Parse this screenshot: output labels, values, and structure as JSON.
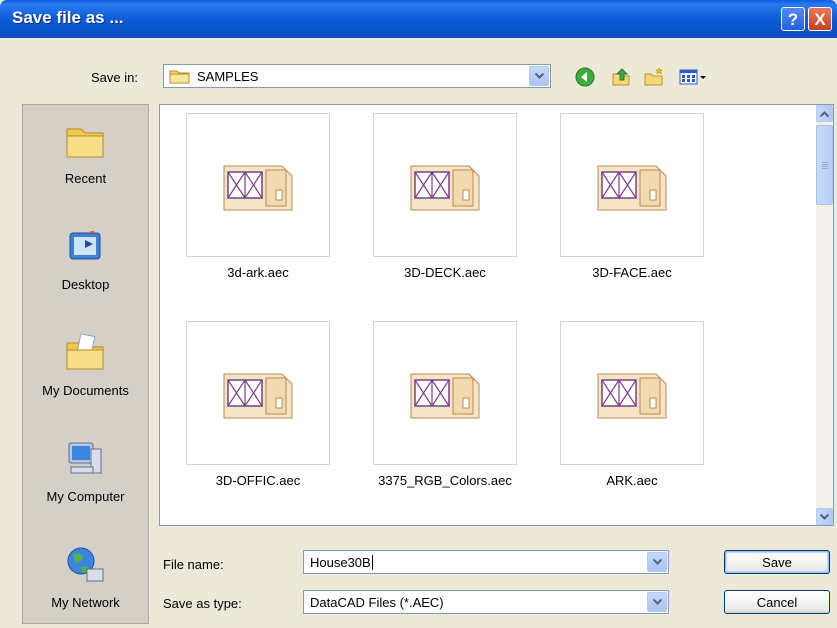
{
  "window": {
    "title": "Save file as ...",
    "help_label": "?",
    "close_label": "X"
  },
  "save_in": {
    "label": "Save in:",
    "value": "SAMPLES"
  },
  "places": [
    {
      "label": "Recent",
      "icon": "recent-folder-icon"
    },
    {
      "label": "Desktop",
      "icon": "desktop-icon"
    },
    {
      "label": "My Documents",
      "icon": "my-documents-icon"
    },
    {
      "label": "My Computer",
      "icon": "my-computer-icon"
    },
    {
      "label": "My Network",
      "icon": "my-network-icon"
    }
  ],
  "files": [
    {
      "name": "3d-ark.aec"
    },
    {
      "name": "3D-DECK.aec"
    },
    {
      "name": "3D-FACE.aec"
    },
    {
      "name": "3D-OFFIC.aec"
    },
    {
      "name": "3375_RGB_Colors.aec"
    },
    {
      "name": "ARK.aec"
    }
  ],
  "file_name": {
    "label": "File name:",
    "value": "House30B"
  },
  "save_as_type": {
    "label": "Save as type:",
    "value": "DataCAD Files (*.AEC)"
  },
  "buttons": {
    "save": "Save",
    "cancel": "Cancel"
  }
}
